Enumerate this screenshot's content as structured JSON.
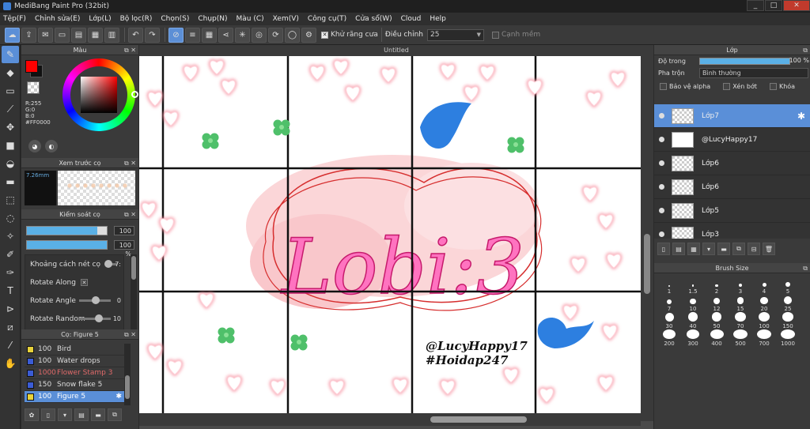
{
  "app": {
    "title": "MediBang Paint Pro (32bit)"
  },
  "window_buttons": [
    "_",
    "□",
    "✕"
  ],
  "menu": [
    "Tệp(F)",
    "Chỉnh sửa(E)",
    "Lớp(L)",
    "Bộ lọc(R)",
    "Chọn(S)",
    "Chụp(N)",
    "Màu (C)",
    "Xem(V)",
    "Công cụ(T)",
    "Cửa sổ(W)",
    "Cloud",
    "Help"
  ],
  "toolbar": {
    "antialias_label": "Khử răng cưa",
    "correction_label": "Điều chỉnh",
    "correction_value": "25",
    "soft_edge_label": "Cạnh mềm"
  },
  "panels": {
    "color_title": "Màu",
    "color_rgb": [
      "R:255",
      "G:0",
      "B:0",
      "#FF0000"
    ],
    "brush_preview_title": "Xem trước cọ",
    "brush_preview_size": "7.26mm",
    "brush_control_title": "Kiểm soát cọ",
    "size_value": "100",
    "opacity_value": "100 %",
    "brush_params": [
      {
        "label": "Khoảng cách nét cọ",
        "value": "7:"
      },
      {
        "label": "Rotate Along",
        "value": ""
      },
      {
        "label": "Rotate Angle",
        "value": "0"
      },
      {
        "label": "Rotate Random",
        "value": "10"
      }
    ],
    "brush_list_title": "Cọ: Figure 5",
    "brushes": [
      {
        "size": "100",
        "name": "Bird",
        "color": "#e8d23a",
        "red": false,
        "selected": false
      },
      {
        "size": "100",
        "name": "Water drops",
        "color": "#3b5cd6",
        "red": false,
        "selected": false
      },
      {
        "size": "1000",
        "name": "Flower Stamp 3",
        "color": "#3b5cd6",
        "red": true,
        "selected": false
      },
      {
        "size": "150",
        "name": "Snow flake 5",
        "color": "#3b5cd6",
        "red": false,
        "selected": false
      },
      {
        "size": "100",
        "name": "Figure 5",
        "color": "#e8d23a",
        "red": false,
        "selected": true
      }
    ]
  },
  "document": {
    "tab_title": "Untitled",
    "watermark_line1": "@LucyHappy17",
    "watermark_line2": "#Hoidap247",
    "logo_text": "Lobi:3"
  },
  "layers_panel": {
    "title": "Lớp",
    "opacity_label": "Độ trong",
    "opacity_value": "100 %",
    "blend_label": "Pha trộn",
    "blend_value": "Bình thường",
    "protect_alpha": "Bảo vệ alpha",
    "clipping": "Xén bớt",
    "lock": "Khóa",
    "layers": [
      {
        "name": "Lớp7",
        "selected": true
      },
      {
        "name": "@LucyHappy17",
        "selected": false
      },
      {
        "name": "Lớp6",
        "selected": false
      },
      {
        "name": "Lớp6",
        "selected": false
      },
      {
        "name": "Lớp5",
        "selected": false
      },
      {
        "name": "Lớp3",
        "selected": false
      }
    ]
  },
  "brush_size_panel": {
    "title": "Brush Size",
    "sizes": [
      "1",
      "1.5",
      "2",
      "3",
      "4",
      "5",
      "7",
      "10",
      "12",
      "15",
      "20",
      "25",
      "30",
      "40",
      "50",
      "70",
      "100",
      "150",
      "200",
      "300",
      "400",
      "500",
      "700",
      "1000"
    ]
  },
  "colors": {
    "accent": "#5a8fd8",
    "primary_color": "#FF0000"
  }
}
